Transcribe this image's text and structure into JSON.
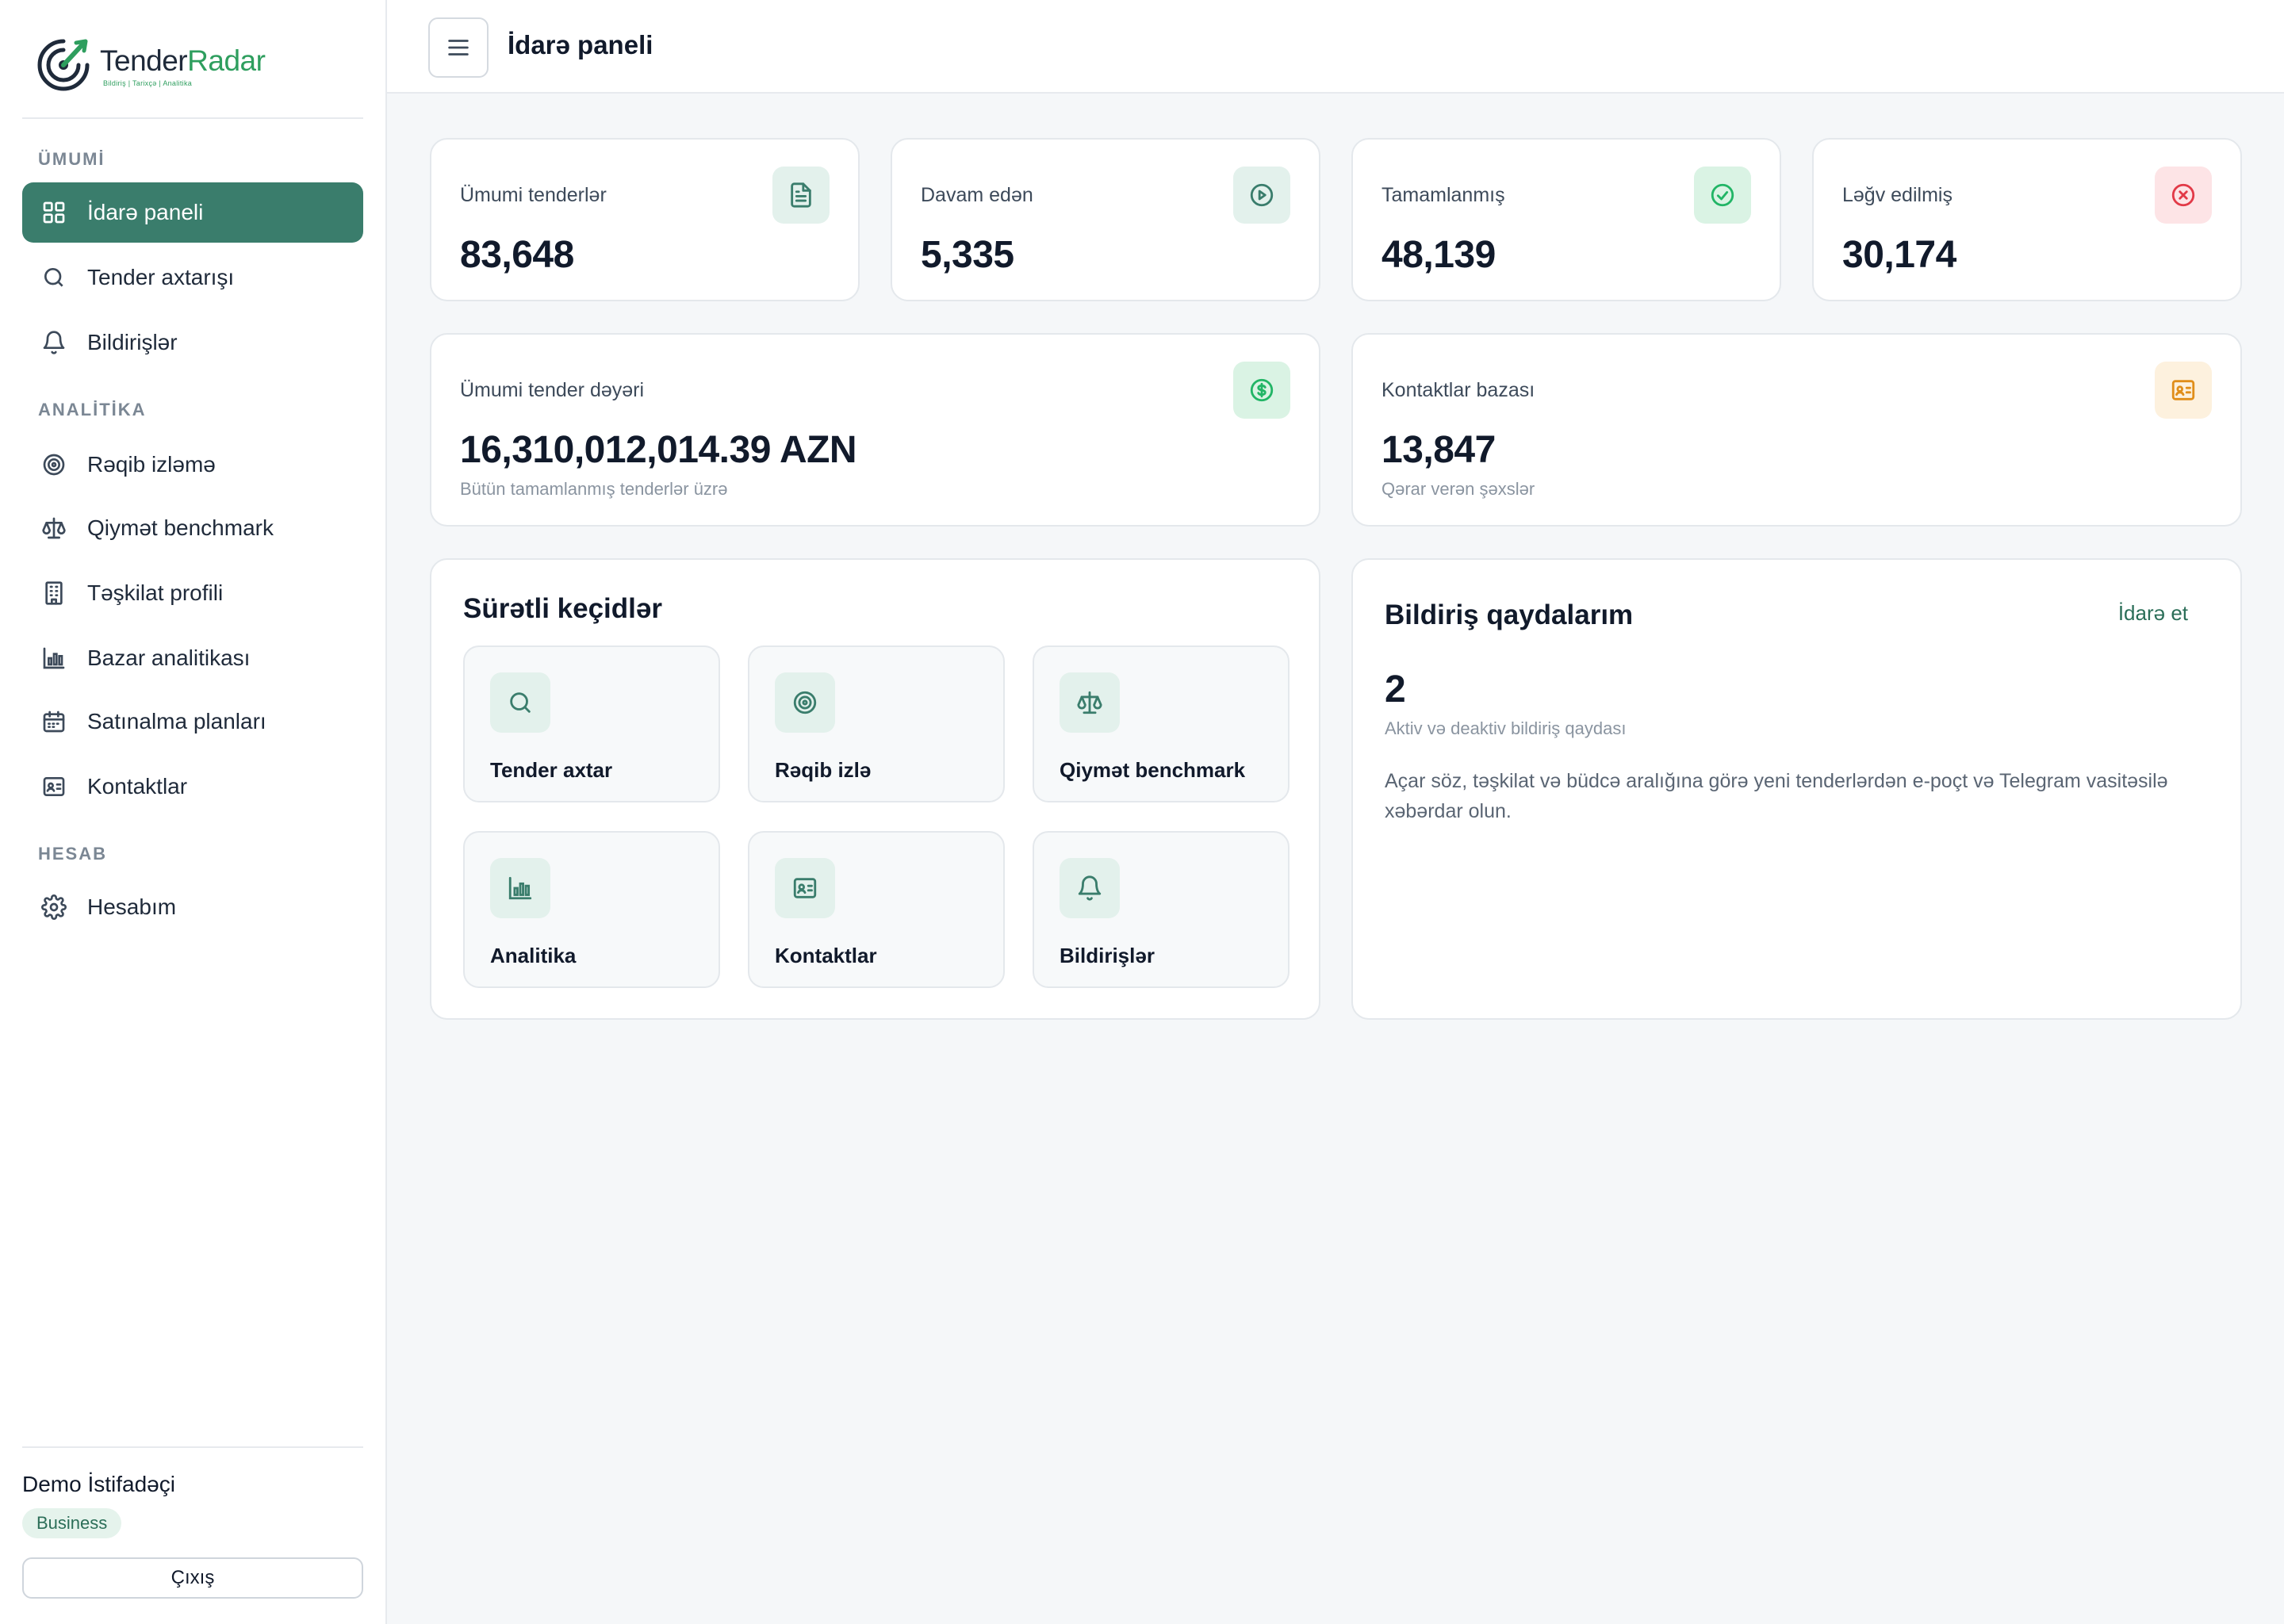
{
  "brand": {
    "name_part1": "Tender",
    "name_part2": "Radar",
    "tagline": "Bildiriş  |  Tarixçə  |  Analitika"
  },
  "sidebar": {
    "sections": [
      {
        "label": "ÜMUMİ"
      },
      {
        "label": "ANALİTİKA"
      },
      {
        "label": "HESAB"
      }
    ],
    "items": [
      {
        "label": "İdarə paneli",
        "icon": "grid-icon",
        "active": true
      },
      {
        "label": "Tender axtarışı",
        "icon": "search-icon"
      },
      {
        "label": "Bildirişlər",
        "icon": "bell-icon"
      },
      {
        "label": "Rəqib izləmə",
        "icon": "target-icon"
      },
      {
        "label": "Qiymət benchmark",
        "icon": "scale-icon"
      },
      {
        "label": "Təşkilat profili",
        "icon": "building-icon"
      },
      {
        "label": "Bazar analitikası",
        "icon": "bar-chart-icon"
      },
      {
        "label": "Satınalma planları",
        "icon": "calendar-icon"
      },
      {
        "label": "Kontaktlar",
        "icon": "contact-card-icon"
      },
      {
        "label": "Hesabım",
        "icon": "gear-icon"
      }
    ],
    "user": {
      "name": "Demo İstifadəçi",
      "plan": "Business",
      "logout_label": "Çıxış"
    }
  },
  "header": {
    "title": "İdarə paneli"
  },
  "stats": [
    {
      "label": "Ümumi tenderlər",
      "value": "83,648",
      "icon": "document-icon"
    },
    {
      "label": "Davam edən",
      "value": "5,335",
      "icon": "play-circle-icon"
    },
    {
      "label": "Tamamlanmış",
      "value": "48,139",
      "icon": "check-circle-icon"
    },
    {
      "label": "Ləğv edilmiş",
      "value": "30,174",
      "icon": "x-circle-icon"
    }
  ],
  "total_value": {
    "label": "Ümumi tender dəyəri",
    "value": "16,310,012,014.39 AZN",
    "sub": "Bütün tamamlanmış tenderlər üzrə",
    "icon": "dollar-circle-icon"
  },
  "contacts_db": {
    "label": "Kontaktlar bazası",
    "value": "13,847",
    "sub": "Qərar verən şəxslər",
    "icon": "contact-card-icon"
  },
  "quick_links": {
    "title": "Sürətli keçidlər",
    "items": [
      {
        "label": "Tender axtar",
        "icon": "search-icon"
      },
      {
        "label": "Rəqib izlə",
        "icon": "target-icon"
      },
      {
        "label": "Qiymət benchmark",
        "icon": "scale-icon"
      },
      {
        "label": "Analitika",
        "icon": "bar-chart-icon"
      },
      {
        "label": "Kontaktlar",
        "icon": "contact-card-icon"
      },
      {
        "label": "Bildirişlər",
        "icon": "bell-icon"
      }
    ]
  },
  "alert_rules": {
    "title": "Bildiriş qaydalarım",
    "manage_label": "İdarə et",
    "count": "2",
    "count_sub": "Aktiv və deaktiv bildiriş qaydası",
    "description": "Açar söz, təşkilat və büdcə aralığına görə yeni tenderlərdən e-poçt və Telegram vasitəsilə xəbərdar olun."
  },
  "colors": {
    "accent": "#3a7d6c",
    "brand_green": "#2e9e5e",
    "success": "#22b566",
    "danger": "#e23a48",
    "warning": "#e08e1a"
  }
}
